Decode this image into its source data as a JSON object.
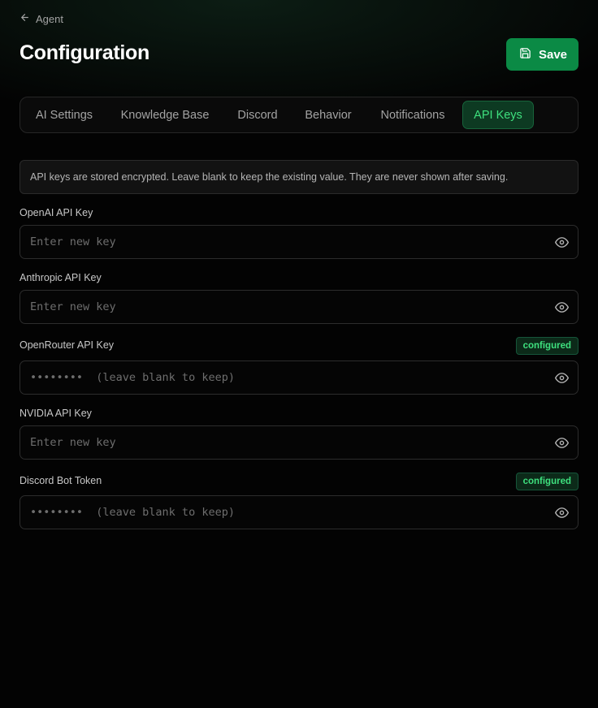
{
  "back_link": {
    "label": "Agent",
    "icon": "arrow-left-icon"
  },
  "page": {
    "title": "Configuration"
  },
  "save_button": {
    "label": "Save",
    "icon": "floppy-disk-icon"
  },
  "tabs": [
    {
      "label": "AI Settings",
      "active": false
    },
    {
      "label": "Knowledge Base",
      "active": false
    },
    {
      "label": "Discord",
      "active": false
    },
    {
      "label": "Behavior",
      "active": false
    },
    {
      "label": "Notifications",
      "active": false
    },
    {
      "label": "API Keys",
      "active": true
    }
  ],
  "notice": {
    "text": "API keys are stored encrypted. Leave blank to keep the existing value. They are never shown after saving."
  },
  "fields": [
    {
      "label": "OpenAI API Key",
      "placeholder": "Enter new key",
      "configured": false
    },
    {
      "label": "Anthropic API Key",
      "placeholder": "Enter new key",
      "configured": false
    },
    {
      "label": "OpenRouter API Key",
      "placeholder": "••••••••  (leave blank to keep)",
      "configured": true,
      "badge": "configured"
    },
    {
      "label": "NVIDIA API Key",
      "placeholder": "Enter new key",
      "configured": false
    },
    {
      "label": "Discord Bot Token",
      "placeholder": "••••••••  (leave blank to keep)",
      "configured": true,
      "badge": "configured"
    }
  ],
  "colors": {
    "accent": "#0b8a45",
    "accent_text": "#3ee07e",
    "background": "#030303"
  }
}
